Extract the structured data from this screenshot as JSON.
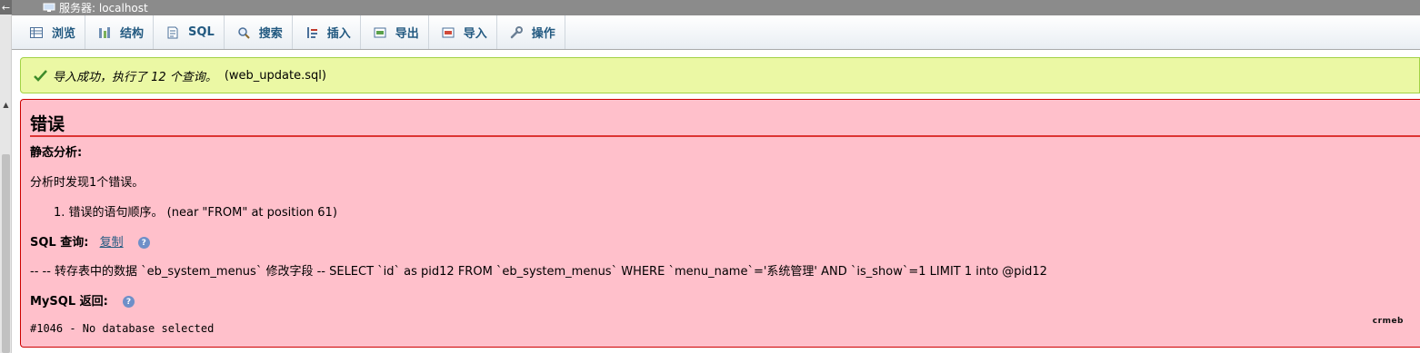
{
  "server": {
    "back_glyph": "←",
    "label": "服务器: localhost"
  },
  "toolbar": {
    "tabs": [
      {
        "label": "浏览",
        "icon": "browse-icon"
      },
      {
        "label": "结构",
        "icon": "structure-icon"
      },
      {
        "label": "SQL",
        "icon": "sql-icon"
      },
      {
        "label": "搜索",
        "icon": "search-icon"
      },
      {
        "label": "插入",
        "icon": "insert-icon"
      },
      {
        "label": "导出",
        "icon": "export-icon"
      },
      {
        "label": "导入",
        "icon": "import-icon"
      },
      {
        "label": "操作",
        "icon": "wrench-icon"
      }
    ]
  },
  "success": {
    "message": "导入成功，执行了 12 个查询。",
    "file": "(web_update.sql)",
    "color": "#ebf8a4"
  },
  "error": {
    "title": "错误",
    "static_analysis_label": "静态分析:",
    "found_text": "分析时发现1个错误。",
    "items": [
      "1. 错误的语句顺序。 (near \"FROM\" at position 61)"
    ],
    "sql_label": "SQL 查询:",
    "copy_label": "复制",
    "help_glyph": "?",
    "sql_text": "-- -- 转存表中的数据 `eb_system_menus` 修改字段 -- SELECT `id` as pid12 FROM `eb_system_menus` WHERE `menu_name`='系统管理' AND `is_show`=1 LIMIT 1 into @pid12",
    "mysql_label": "MySQL 返回:",
    "mysql_text": "#1046 - No database selected",
    "logo_text": "crmeb",
    "color": "#ffc0cb"
  }
}
